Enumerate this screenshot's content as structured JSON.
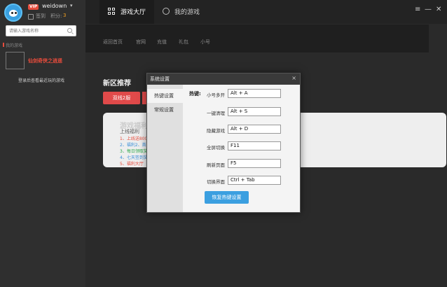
{
  "user": {
    "vip_badge": "VIP",
    "name": "weidown",
    "signin_label": "签到",
    "points_label": "积分:",
    "points_value": "3"
  },
  "sidebar": {
    "search_placeholder": "请输入游戏名称",
    "mygames_heading": "我的游戏",
    "game_name": "仙剑奇侠之逍遥",
    "login_hint": "登录后查看最近玩的游戏"
  },
  "topbar": {
    "tab_hall": "游戏大厅",
    "tab_mygames": "我的游戏",
    "menu_icon": "≡",
    "minimize_icon": "—",
    "close_icon": "✕"
  },
  "subnav": {
    "items": [
      "返回首页",
      "官网",
      "充值",
      "礼包",
      "小号"
    ]
  },
  "main": {
    "section_title": "新区推荐",
    "red_button": "双线2服",
    "card_title": "游戏福利",
    "card_sub": "上线福利",
    "card_lines": [
      {
        "text": "1、上线送800",
        "color": "#e74c3c"
      },
      {
        "text": "2、福利2、首",
        "color": "#3a8fd8"
      },
      {
        "text": "3、每日领取奖",
        "color": "#2aa84a"
      },
      {
        "text": "4、七天签到奖",
        "color": "#3a8fd8"
      },
      {
        "text": "5、福利大厅",
        "color": "#e74c3c"
      }
    ]
  },
  "dialog": {
    "title": "系统设置",
    "close": "×",
    "tabs": [
      "热键设置",
      "常规设置"
    ],
    "hotkey_caption": "热键:",
    "hotkeys": [
      {
        "label": "小号多开",
        "value": "Alt + A"
      },
      {
        "label": "一键清理",
        "value": "Alt + S"
      },
      {
        "label": "隐藏游戏",
        "value": "Alt + D"
      },
      {
        "label": "全屏切换",
        "value": "F11"
      },
      {
        "label": "刷新页面",
        "value": "F5"
      },
      {
        "label": "切换界面",
        "value": "Ctrl + Tab"
      }
    ],
    "restore_button": "恢复热键设置"
  }
}
